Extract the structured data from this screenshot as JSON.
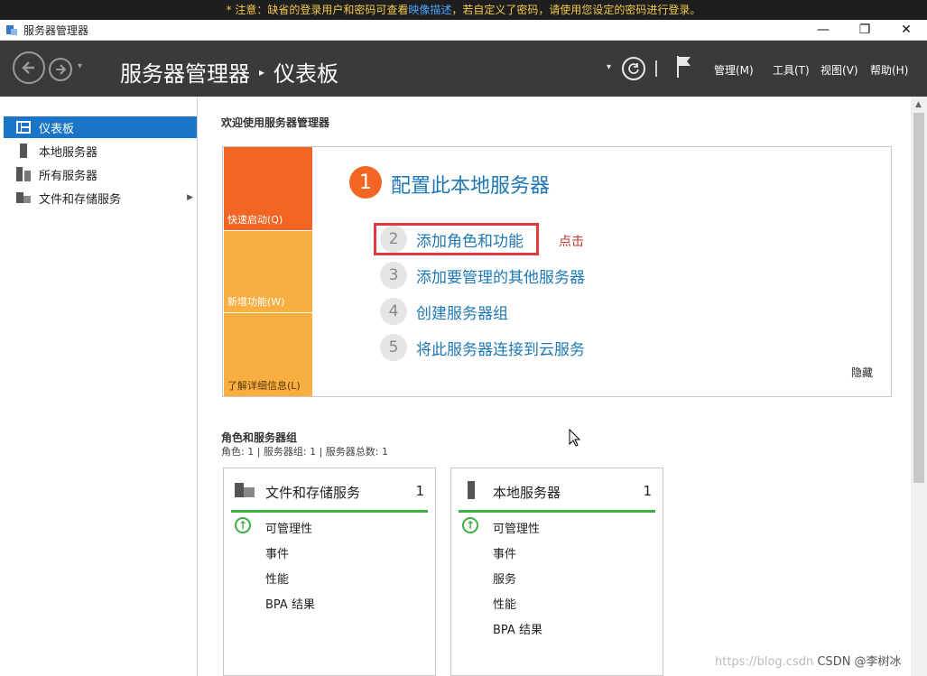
{
  "notice": {
    "text_before": "* 注意：缺省的登录用户和密码可查看",
    "link": "映像描述",
    "text_after": "，若自定义了密码，请使用您设定的密码进行登录。"
  },
  "window": {
    "title": "服务器管理器",
    "minimize": "—",
    "restore": "❐",
    "close": "✕"
  },
  "header": {
    "breadcrumb_root": "服务器管理器",
    "separator": "▸",
    "breadcrumb_current": "仪表板",
    "dropdown": "▾",
    "menus": [
      "管理(M)",
      "工具(T)",
      "视图(V)",
      "帮助(H)"
    ]
  },
  "sidebar": {
    "items": [
      {
        "label": "仪表板",
        "icon": "dashboard-icon",
        "active": true
      },
      {
        "label": "本地服务器",
        "icon": "server-icon"
      },
      {
        "label": "所有服务器",
        "icon": "servers-icon"
      },
      {
        "label": "文件和存储服务",
        "icon": "file-storage-icon",
        "expand": "▶"
      }
    ]
  },
  "welcome": {
    "title": "欢迎使用服务器管理器",
    "tabs": [
      "快速启动(Q)",
      "新增功能(W)",
      "了解详细信息(L)"
    ],
    "step1_num": "1",
    "step1_text": "配置此本地服务器",
    "steps": [
      {
        "num": "2",
        "text": "添加角色和功能"
      },
      {
        "num": "3",
        "text": "添加要管理的其他服务器"
      },
      {
        "num": "4",
        "text": "创建服务器组"
      },
      {
        "num": "5",
        "text": "将此服务器连接到云服务"
      }
    ],
    "annotation": "点击",
    "hide": "隐藏"
  },
  "roles": {
    "title": "角色和服务器组",
    "summary": "角色: 1 | 服务器组: 1 | 服务器总数: 1",
    "cards": [
      {
        "title": "文件和存储服务",
        "count": "1",
        "rows": [
          "可管理性",
          "事件",
          "性能",
          "BPA 结果"
        ]
      },
      {
        "title": "本地服务器",
        "count": "1",
        "rows": [
          "可管理性",
          "事件",
          "服务",
          "性能",
          "BPA 结果"
        ]
      }
    ]
  },
  "watermark": {
    "url": "https://blog.csdn",
    "brand": "CSDN @李树冰"
  },
  "colors": {
    "accent": "#1a75c7",
    "orange": "#f26522",
    "light_orange": "#f9ae42",
    "status_green": "#3cb043",
    "highlight_red": "#e0393e"
  }
}
